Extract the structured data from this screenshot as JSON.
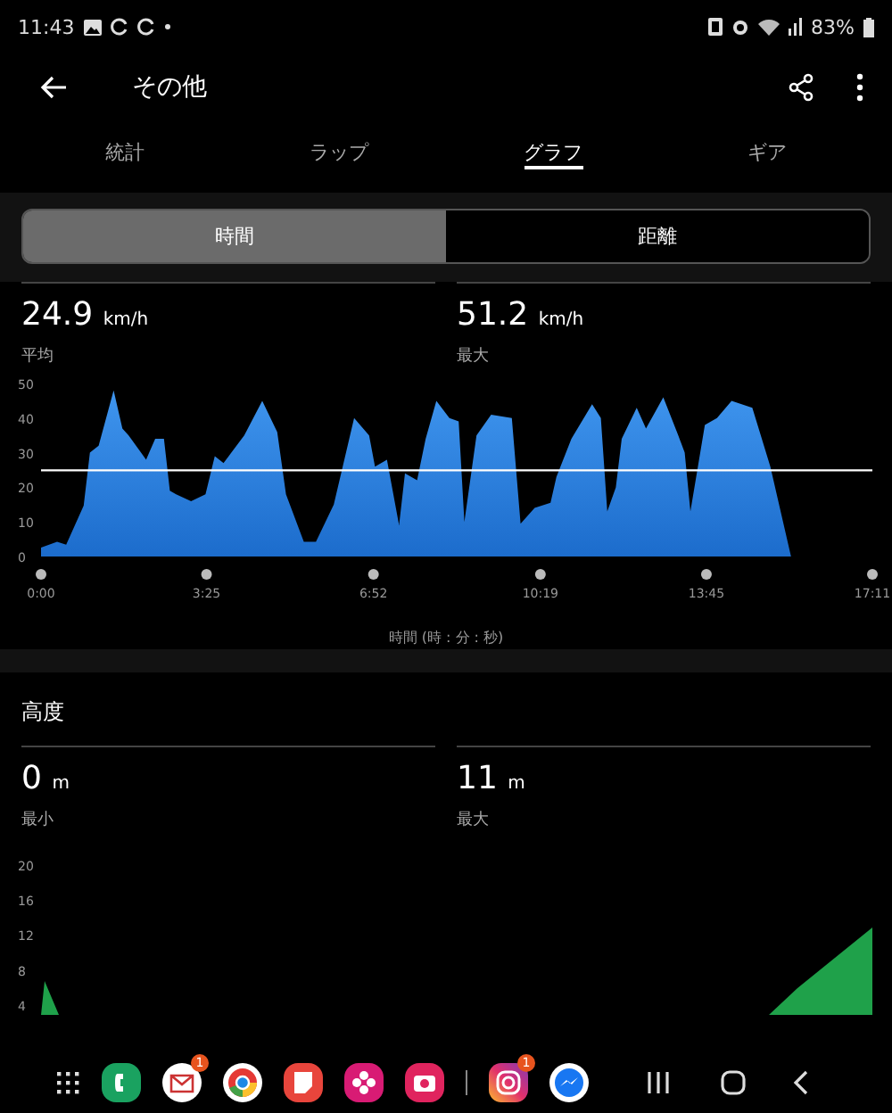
{
  "status_bar": {
    "time": "11:43",
    "battery": "83%"
  },
  "header": {
    "title": "その他"
  },
  "tabs": [
    {
      "label": "統計",
      "selected": false
    },
    {
      "label": "ラップ",
      "selected": false
    },
    {
      "label": "グラフ",
      "selected": true
    },
    {
      "label": "ギア",
      "selected": false
    }
  ],
  "segments": [
    {
      "label": "時間",
      "selected": true
    },
    {
      "label": "距離",
      "selected": false
    }
  ],
  "speed": {
    "stats": [
      {
        "value": "24.9",
        "unit": "km/h",
        "label": "平均"
      },
      {
        "value": "51.2",
        "unit": "km/h",
        "label": "最大"
      }
    ],
    "chart_data": {
      "type": "area",
      "xlabel": "時間 (時 : 分 : 秒)",
      "xlim": [
        0,
        17.18
      ],
      "ylim": [
        0,
        50
      ],
      "x": [
        0,
        0.33,
        0.52,
        0.88,
        1.01,
        1.19,
        1.5,
        1.68,
        1.81,
        2.17,
        2.36,
        2.54,
        2.66,
        2.79,
        3.1,
        3.4,
        3.59,
        3.77,
        4.2,
        4.57,
        4.88,
        5.06,
        5.43,
        5.68,
        6.05,
        6.47,
        6.78,
        6.9,
        7.15,
        7.4,
        7.52,
        7.77,
        7.95,
        8.17,
        8.44,
        8.63,
        8.75,
        9.0,
        9.3,
        9.73,
        9.91,
        10.2,
        10.53,
        10.65,
        10.96,
        11.39,
        11.57,
        11.7,
        11.88,
        12.0,
        12.31,
        12.5,
        12.86,
        13.17,
        13.3,
        13.42,
        13.72,
        13.97,
        14.27,
        14.7,
        15.07,
        15.5
      ],
      "series": [
        {
          "color": "#3f95ee",
          "values": [
            2.6,
            4.3,
            3.4,
            14.7,
            30,
            32,
            48,
            37,
            35,
            28,
            34,
            34,
            19,
            18,
            16,
            18,
            29,
            27,
            35,
            45,
            36,
            18,
            4.3,
            4.3,
            15,
            40,
            35,
            26,
            28,
            9,
            24,
            22,
            34,
            45,
            40,
            39,
            10,
            35,
            41,
            40,
            9.5,
            14,
            15.5,
            23,
            34,
            44,
            40,
            13,
            20,
            34,
            43,
            37,
            46,
            35,
            30,
            13,
            38,
            40,
            45,
            43,
            26,
            0
          ]
        }
      ],
      "xticks": [
        {
          "value": 0,
          "label": "0:00"
        },
        {
          "value": 3.42,
          "label": "3:25"
        },
        {
          "value": 6.87,
          "label": "6:52"
        },
        {
          "value": 10.32,
          "label": "10:19"
        },
        {
          "value": 13.75,
          "label": "13:45"
        },
        {
          "value": 17.18,
          "label": "17:11"
        }
      ],
      "yticks": [
        0,
        10,
        20,
        30,
        40,
        50
      ],
      "ref_lines": [
        {
          "axis": "y",
          "value": 24.9
        }
      ]
    }
  },
  "altitude": {
    "title": "高度",
    "stats": [
      {
        "value": "0",
        "unit": "m",
        "label": "最小"
      },
      {
        "value": "11",
        "unit": "m",
        "label": "最大"
      }
    ],
    "y_axis_labels": [
      "20",
      "16",
      "12",
      "8",
      "4"
    ]
  },
  "taskbar": {
    "apps": [
      {
        "kind": "phone"
      },
      {
        "kind": "mail",
        "badge": "1"
      },
      {
        "kind": "browser"
      },
      {
        "kind": "notes"
      },
      {
        "kind": "flower"
      },
      {
        "kind": "camera"
      },
      {
        "kind": "divider"
      },
      {
        "kind": "instagram",
        "badge": "1"
      },
      {
        "kind": "messenger"
      }
    ]
  }
}
